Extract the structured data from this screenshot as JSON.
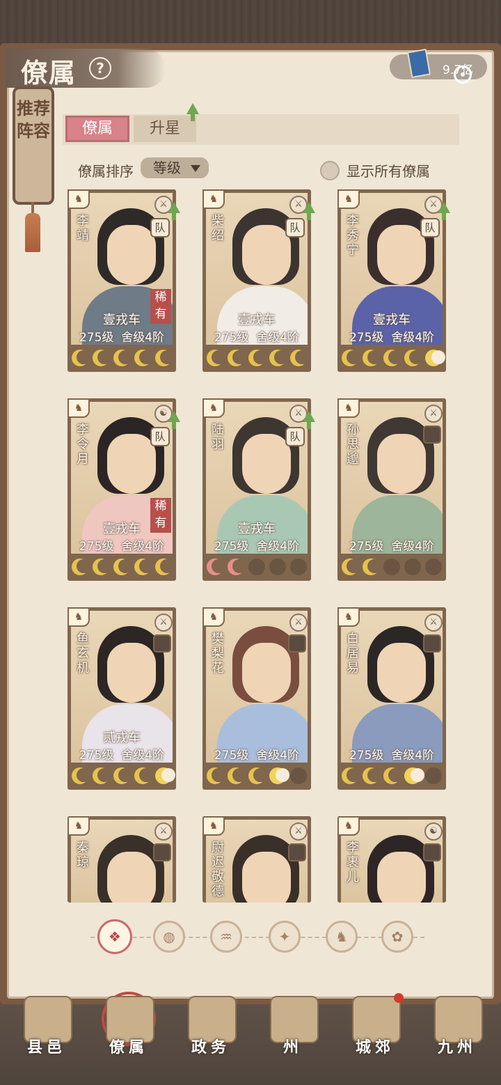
{
  "header": {
    "title": "僚属",
    "currency_value": "9.7亿"
  },
  "bookmark": {
    "label": "推荐阵容"
  },
  "tabs": [
    {
      "label": "僚属",
      "active": true
    },
    {
      "label": "升星",
      "active": false
    }
  ],
  "sort": {
    "label": "僚属排序",
    "value": "等级"
  },
  "toggle": {
    "label": "显示所有僚属"
  },
  "cards": [
    {
      "name": "李\n靖",
      "vehicle": "壹戎车",
      "level": "275级",
      "house": "舍级4阶",
      "team": "队",
      "rare": "稀有",
      "moons": [
        "gold",
        "gold",
        "gold",
        "gold",
        "gold"
      ],
      "upgrade": true
    },
    {
      "name": "柴\n绍",
      "vehicle": "壹戎车",
      "level": "275级",
      "house": "舍级4阶",
      "team": "队",
      "rare": "",
      "moons": [
        "gold",
        "gold",
        "gold",
        "gold",
        "gold"
      ],
      "upgrade": true
    },
    {
      "name": "李\n秀\n宁",
      "vehicle": "壹戎车",
      "level": "275级",
      "house": "舍级4阶",
      "team": "队",
      "rare": "",
      "moons": [
        "gold",
        "gold",
        "gold",
        "gold",
        "bright"
      ],
      "upgrade": true
    },
    {
      "name": "李\n令\n月",
      "vehicle": "壹戎车",
      "level": "275级",
      "house": "舍级4阶",
      "team": "队",
      "rare": "稀有",
      "moons": [
        "gold",
        "gold",
        "gold",
        "gold",
        "gold"
      ],
      "upgrade": true
    },
    {
      "name": "陆\n羽",
      "vehicle": "壹戎车",
      "level": "275级",
      "house": "舍级4阶",
      "team": "队",
      "rare": "",
      "moons": [
        "pink",
        "pink",
        "empty",
        "empty",
        "empty"
      ],
      "upgrade": true
    },
    {
      "name": "孙\n思\n邈",
      "vehicle": "",
      "level": "275级",
      "house": "舍级4阶",
      "team": "",
      "rare": "",
      "moons": [
        "gold",
        "gold",
        "empty",
        "empty",
        "empty"
      ],
      "upgrade": false
    },
    {
      "name": "鱼\n玄\n机",
      "vehicle": "贰戎车",
      "level": "275级",
      "house": "舍级4阶",
      "team": "",
      "rare": "",
      "moons": [
        "gold",
        "gold",
        "gold",
        "gold",
        "bright"
      ],
      "upgrade": false
    },
    {
      "name": "樊\n梨\n花",
      "vehicle": "",
      "level": "275级",
      "house": "舍级4阶",
      "team": "",
      "rare": "",
      "moons": [
        "gold",
        "gold",
        "gold",
        "bright",
        "empty"
      ],
      "upgrade": false
    },
    {
      "name": "白\n居\n易",
      "vehicle": "",
      "level": "275级",
      "house": "舍级4阶",
      "team": "",
      "rare": "",
      "moons": [
        "gold",
        "gold",
        "gold",
        "bright",
        "empty"
      ],
      "upgrade": false
    },
    {
      "name": "秦\n琼",
      "vehicle": "",
      "level": "",
      "house": "",
      "team": "",
      "rare": "",
      "moons": [],
      "upgrade": false
    },
    {
      "name": "尉\n迟\n敬\n德",
      "vehicle": "",
      "level": "",
      "house": "",
      "team": "",
      "rare": "",
      "moons": [],
      "upgrade": false
    },
    {
      "name": "李\n裹\n儿",
      "vehicle": "",
      "level": "",
      "house": "",
      "team": "",
      "rare": "",
      "moons": [],
      "upgrade": false
    }
  ],
  "filters": [
    {
      "icon": "all-icon",
      "glyph": "❖",
      "active": true
    },
    {
      "icon": "faction-1-icon",
      "glyph": "◍",
      "active": false
    },
    {
      "icon": "faction-2-icon",
      "glyph": "♒",
      "active": false
    },
    {
      "icon": "faction-3-icon",
      "glyph": "✦",
      "active": false
    },
    {
      "icon": "faction-4-icon",
      "glyph": "♞",
      "active": false
    },
    {
      "icon": "faction-5-icon",
      "glyph": "✿",
      "active": false
    }
  ],
  "nav": [
    {
      "label": "县邑",
      "active": false
    },
    {
      "label": "僚属",
      "active": true
    },
    {
      "label": "政务",
      "active": false
    },
    {
      "label": "州",
      "active": false
    },
    {
      "label": "城郊",
      "active": false
    },
    {
      "label": "九州",
      "active": false
    }
  ],
  "colors": {
    "accent_pink": "#d8828a",
    "nav_active_ring": "#c14a40",
    "card_frame": "#7f664d",
    "moon_gold": "#e6c24e"
  }
}
